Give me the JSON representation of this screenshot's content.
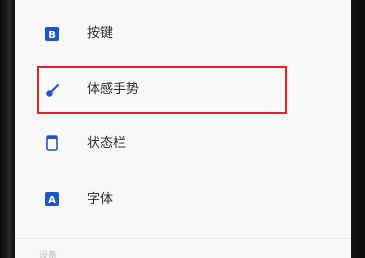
{
  "settings": {
    "items": [
      {
        "label": "按键",
        "icon": "button-b-icon",
        "glyph": "B"
      },
      {
        "label": "体感手势",
        "icon": "motion-gesture-icon"
      },
      {
        "label": "状态栏",
        "icon": "status-bar-icon"
      },
      {
        "label": "字体",
        "icon": "font-a-icon",
        "glyph": "A"
      }
    ],
    "section_header": "设备",
    "highlight_color": "#e3232a",
    "icon_color": "#1a56c8"
  }
}
